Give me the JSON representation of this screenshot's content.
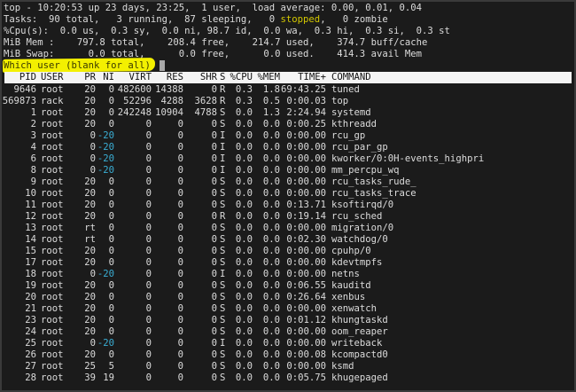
{
  "summary": {
    "line1": "top - 10:20:53 up 23 days, 23:25,  1 user,  load average: 0.00, 0.01, 0.04",
    "tasks_prefix": "Tasks:  90 total,   3 running,  87 sleeping,   0 ",
    "tasks_stopped": "stopped",
    "tasks_suffix": ",   0 zombie",
    "cpu": "%Cpu(s):  0.0 us,  0.3 sy,  0.0 ni, 98.7 id,  0.0 wa,  0.3 hi,  0.3 si,  0.3 st",
    "mem": "MiB Mem :    797.8 total,    208.4 free,    214.7 used,    374.7 buff/cache",
    "swap": "MiB Swap:      0.0 total,      0.0 free,      0.0 used.    414.3 avail Mem"
  },
  "prompt": "Which user (blank for all)",
  "colors": {
    "stopped": "#d4c800",
    "negative_nice": "#3aaed4",
    "highlight": "#f3f000",
    "background": "#1b1b1b"
  },
  "columns": [
    "PID",
    "USER",
    "PR",
    "NI",
    "VIRT",
    "RES",
    "SHR",
    "S",
    "%CPU",
    "%MEM",
    "TIME+",
    "COMMAND"
  ],
  "processes": [
    [
      "9646",
      "root",
      "20",
      "0",
      "482600",
      "14388",
      "0",
      "R",
      "0.3",
      "1.8",
      "69:43.25",
      "tuned"
    ],
    [
      "569873",
      "rack",
      "20",
      "0",
      "52296",
      "4288",
      "3628",
      "R",
      "0.3",
      "0.5",
      "0:00.03",
      "top"
    ],
    [
      "1",
      "root",
      "20",
      "0",
      "242248",
      "10904",
      "4788",
      "S",
      "0.0",
      "1.3",
      "2:24.94",
      "systemd"
    ],
    [
      "2",
      "root",
      "20",
      "0",
      "0",
      "0",
      "0",
      "S",
      "0.0",
      "0.0",
      "0:00.25",
      "kthreadd"
    ],
    [
      "3",
      "root",
      "0",
      "-20",
      "0",
      "0",
      "0",
      "I",
      "0.0",
      "0.0",
      "0:00.00",
      "rcu_gp"
    ],
    [
      "4",
      "root",
      "0",
      "-20",
      "0",
      "0",
      "0",
      "I",
      "0.0",
      "0.0",
      "0:00.00",
      "rcu_par_gp"
    ],
    [
      "6",
      "root",
      "0",
      "-20",
      "0",
      "0",
      "0",
      "I",
      "0.0",
      "0.0",
      "0:00.00",
      "kworker/0:0H-events_highpri"
    ],
    [
      "8",
      "root",
      "0",
      "-20",
      "0",
      "0",
      "0",
      "I",
      "0.0",
      "0.0",
      "0:00.00",
      "mm_percpu_wq"
    ],
    [
      "9",
      "root",
      "20",
      "0",
      "0",
      "0",
      "0",
      "S",
      "0.0",
      "0.0",
      "0:00.00",
      "rcu_tasks_rude_"
    ],
    [
      "10",
      "root",
      "20",
      "0",
      "0",
      "0",
      "0",
      "S",
      "0.0",
      "0.0",
      "0:00.00",
      "rcu_tasks_trace"
    ],
    [
      "11",
      "root",
      "20",
      "0",
      "0",
      "0",
      "0",
      "S",
      "0.0",
      "0.0",
      "0:13.71",
      "ksoftirqd/0"
    ],
    [
      "12",
      "root",
      "20",
      "0",
      "0",
      "0",
      "0",
      "R",
      "0.0",
      "0.0",
      "0:19.14",
      "rcu_sched"
    ],
    [
      "13",
      "root",
      "rt",
      "0",
      "0",
      "0",
      "0",
      "S",
      "0.0",
      "0.0",
      "0:00.00",
      "migration/0"
    ],
    [
      "14",
      "root",
      "rt",
      "0",
      "0",
      "0",
      "0",
      "S",
      "0.0",
      "0.0",
      "0:02.30",
      "watchdog/0"
    ],
    [
      "15",
      "root",
      "20",
      "0",
      "0",
      "0",
      "0",
      "S",
      "0.0",
      "0.0",
      "0:00.00",
      "cpuhp/0"
    ],
    [
      "17",
      "root",
      "20",
      "0",
      "0",
      "0",
      "0",
      "S",
      "0.0",
      "0.0",
      "0:00.00",
      "kdevtmpfs"
    ],
    [
      "18",
      "root",
      "0",
      "-20",
      "0",
      "0",
      "0",
      "I",
      "0.0",
      "0.0",
      "0:00.00",
      "netns"
    ],
    [
      "19",
      "root",
      "20",
      "0",
      "0",
      "0",
      "0",
      "S",
      "0.0",
      "0.0",
      "0:06.55",
      "kauditd"
    ],
    [
      "20",
      "root",
      "20",
      "0",
      "0",
      "0",
      "0",
      "S",
      "0.0",
      "0.0",
      "0:26.64",
      "xenbus"
    ],
    [
      "21",
      "root",
      "20",
      "0",
      "0",
      "0",
      "0",
      "S",
      "0.0",
      "0.0",
      "0:00.00",
      "xenwatch"
    ],
    [
      "23",
      "root",
      "20",
      "0",
      "0",
      "0",
      "0",
      "S",
      "0.0",
      "0.0",
      "0:01.12",
      "khungtaskd"
    ],
    [
      "24",
      "root",
      "20",
      "0",
      "0",
      "0",
      "0",
      "S",
      "0.0",
      "0.0",
      "0:00.00",
      "oom_reaper"
    ],
    [
      "25",
      "root",
      "0",
      "-20",
      "0",
      "0",
      "0",
      "I",
      "0.0",
      "0.0",
      "0:00.00",
      "writeback"
    ],
    [
      "26",
      "root",
      "20",
      "0",
      "0",
      "0",
      "0",
      "S",
      "0.0",
      "0.0",
      "0:00.08",
      "kcompactd0"
    ],
    [
      "27",
      "root",
      "25",
      "5",
      "0",
      "0",
      "0",
      "S",
      "0.0",
      "0.0",
      "0:00.00",
      "ksmd"
    ],
    [
      "28",
      "root",
      "39",
      "19",
      "0",
      "0",
      "0",
      "S",
      "0.0",
      "0.0",
      "0:05.75",
      "khugepaged"
    ]
  ]
}
